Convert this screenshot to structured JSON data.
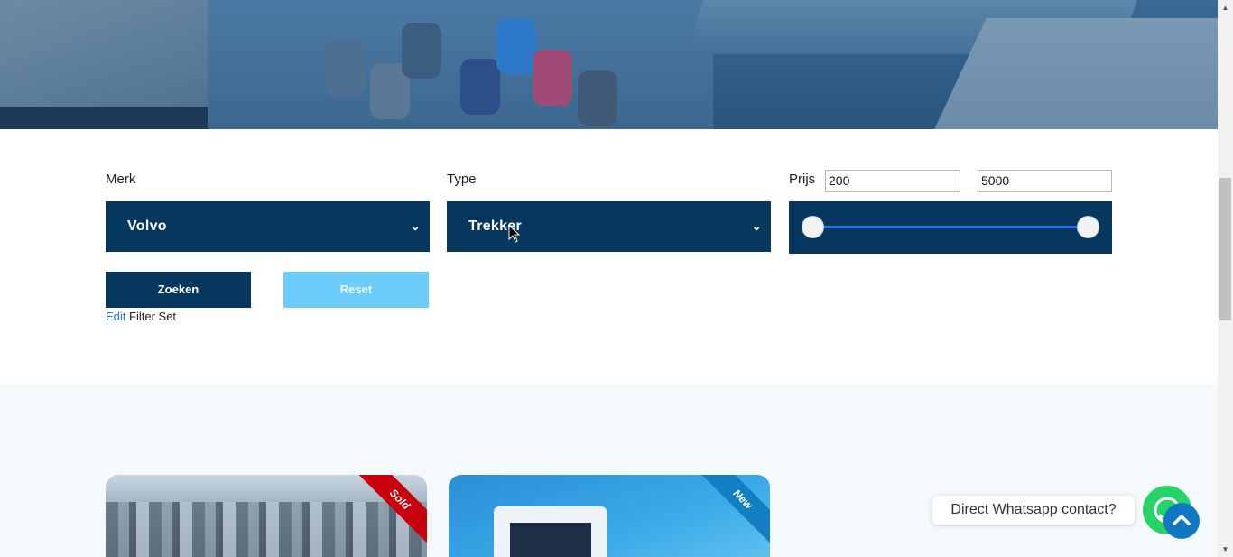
{
  "filters": {
    "merk": {
      "label": "Merk",
      "value": "Volvo"
    },
    "type": {
      "label": "Type",
      "value": "Trekker"
    },
    "prijs": {
      "label": "Prijs",
      "min": "200",
      "max": "5000"
    },
    "search_button": "Zoeken",
    "reset_button": "Reset",
    "edit_link": "Edit",
    "edit_suffix": "Filter Set"
  },
  "listings": [
    {
      "badge": "Sold",
      "badge_color": "#c8000d"
    },
    {
      "badge": "New",
      "badge_color": "#127ec4"
    }
  ],
  "whatsapp": {
    "label": "Direct Whatsapp contact?",
    "icon": "whatsapp-icon",
    "color": "#25d366"
  },
  "scroll_top": {
    "icon": "chevron-up-icon"
  },
  "colors": {
    "primary": "#06385f",
    "accent_light": "#6ccdfa",
    "link": "#2a6fd6"
  }
}
